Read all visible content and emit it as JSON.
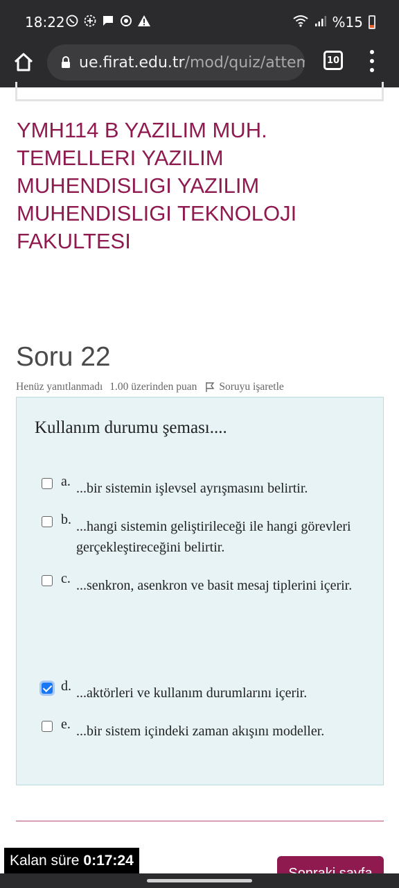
{
  "status_bar": {
    "time": "18:22",
    "battery": "%15",
    "icons": [
      "whatsapp-icon",
      "signal-messenger-icon",
      "chat-icon",
      "sync-icon",
      "warning-icon",
      "wifi-icon",
      "cell-signal-icon",
      "battery-icon"
    ]
  },
  "browser": {
    "url_host": "ue.firat.edu.tr",
    "url_path": "/mod/quiz/attemp",
    "tab_count": "10"
  },
  "course": {
    "title": "YMH114 B YAZILIM MUH. TEMELLERI YAZILIM MUHENDISLIGI YAZILIM MUHENDISLIGI TEKNOLOJI FAKULTESI"
  },
  "question": {
    "number_label": "Soru 22",
    "status": "Henüz yanıtlanmadı",
    "points": "1.00 üzerinden puan",
    "flag_label": "Soruyu işaretle",
    "text": "Kullanım durumu şeması....",
    "options": [
      {
        "letter": "a.",
        "text": "...bir sistemin işlevsel ayrışmasını belirtir.",
        "checked": false
      },
      {
        "letter": "b.",
        "text": "...hangi sistemin geliştirileceği ile hangi görevleri gerçekleştireceğini belirtir.",
        "checked": false
      },
      {
        "letter": "c.",
        "text": "...senkron, asenkron ve basit mesaj tiplerini içerir.",
        "checked": false
      },
      {
        "letter": "d.",
        "text": "...aktörleri ve kullanım durumlarını içerir.",
        "checked": true
      },
      {
        "letter": "e.",
        "text": "...bir sistem içindeki zaman akışını modeller.",
        "checked": false
      }
    ]
  },
  "footer": {
    "timer_label": "Kalan süre",
    "timer_value": "0:17:24",
    "next_button": "Sonraki sayfa"
  },
  "colors": {
    "brand": "#8f1a4f",
    "question_bg": "#e7f3f5",
    "checkbox_checked": "#1877f2"
  }
}
